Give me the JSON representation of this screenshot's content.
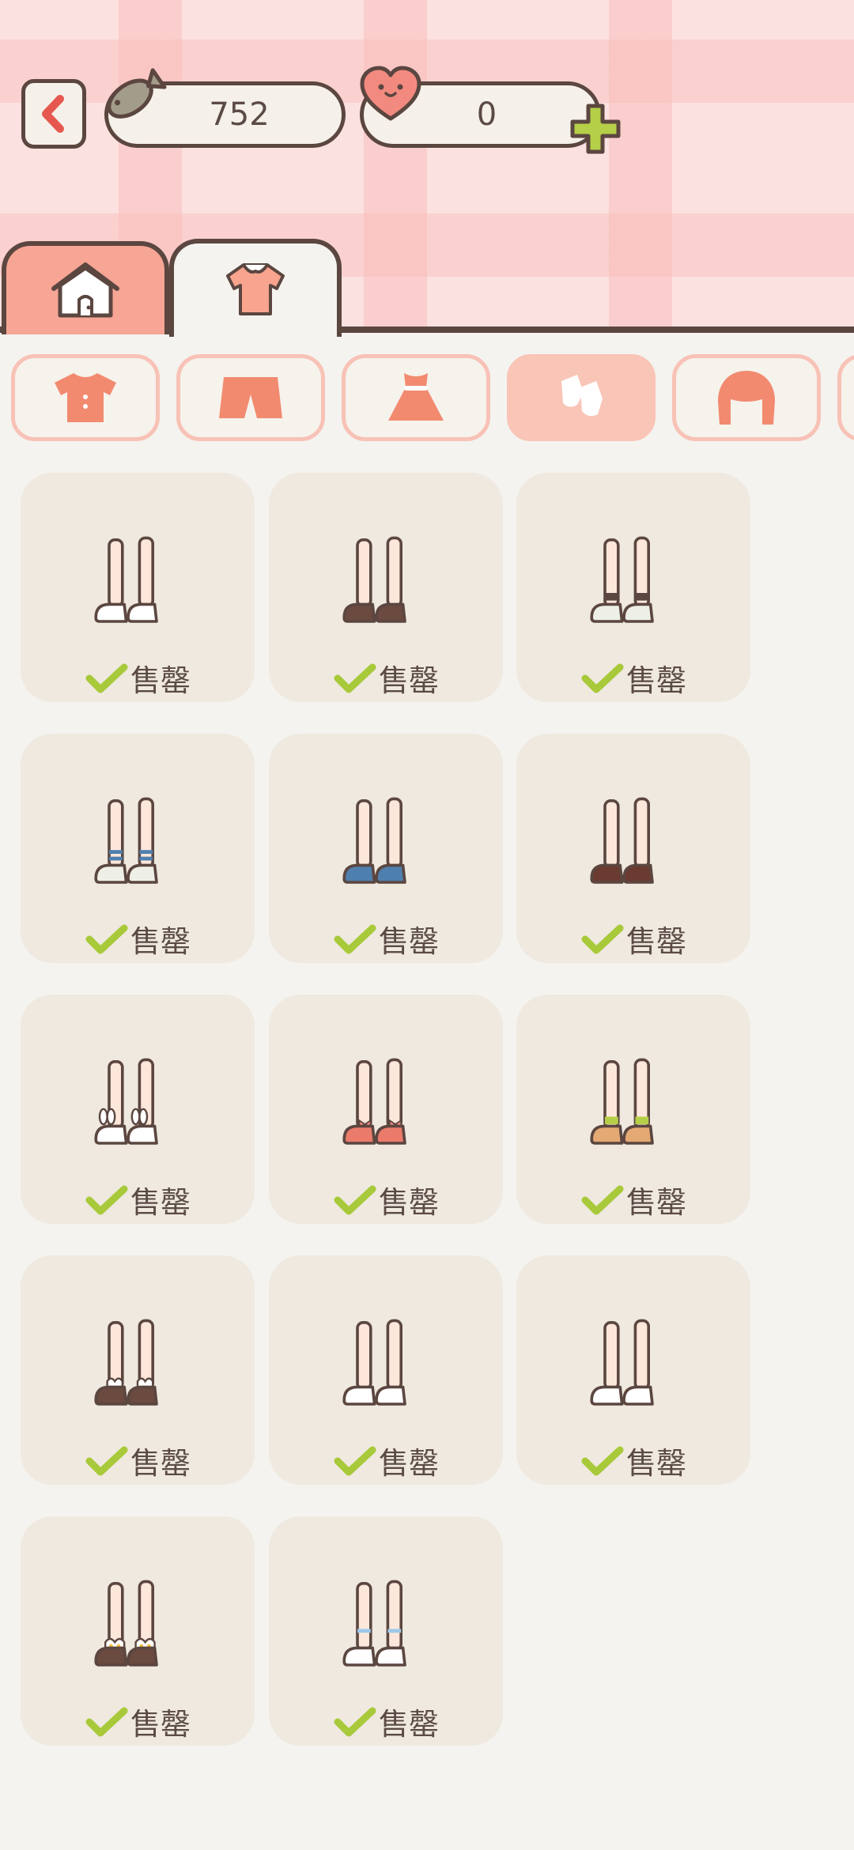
{
  "currency": {
    "fish_count": "752",
    "heart_count": "0"
  },
  "tabs": [
    {
      "name": "home",
      "icon": "house-icon"
    },
    {
      "name": "clothes",
      "icon": "shirt-icon"
    }
  ],
  "categories": [
    {
      "icon": "tshirt-icon"
    },
    {
      "icon": "shorts-icon"
    },
    {
      "icon": "dress-icon"
    },
    {
      "icon": "socks-icon",
      "active": true
    },
    {
      "icon": "hair-icon"
    }
  ],
  "items": [
    {
      "status": "售罄",
      "shoe_color": "#ffffff",
      "sock": "none"
    },
    {
      "status": "售罄",
      "shoe_color": "#6b4a40",
      "sock": "none"
    },
    {
      "status": "售罄",
      "shoe_color": "#eef0e8",
      "sock": "dark"
    },
    {
      "status": "售罄",
      "shoe_color": "#eef0e8",
      "sock": "blue-stripe"
    },
    {
      "status": "售罄",
      "shoe_color": "#4f7fae",
      "sock": "none"
    },
    {
      "status": "售罄",
      "shoe_color": "#6b3a30",
      "sock": "none"
    },
    {
      "status": "售罄",
      "shoe_color": "#ffffff",
      "sock": "bunny"
    },
    {
      "status": "售罄",
      "shoe_color": "#ea7b6b",
      "sock": "bow"
    },
    {
      "status": "售罄",
      "shoe_color": "#e5a974",
      "sock": "green"
    },
    {
      "status": "售罄",
      "shoe_color": "#6b4a40",
      "sock": "ruffle"
    },
    {
      "status": "售罄",
      "shoe_color": "#ffffff",
      "sock": "pink-pom"
    },
    {
      "status": "售罄",
      "shoe_color": "#ffffff",
      "sock": "none"
    },
    {
      "status": "售罄",
      "shoe_color": "#6b4a40",
      "sock": "yellow-frill"
    },
    {
      "status": "售罄",
      "shoe_color": "#ffffff",
      "sock": "blue-lace"
    }
  ],
  "colors": {
    "accent": "#f7a595",
    "outline": "#5b4640",
    "check": "#a8c93a",
    "card": "#efe9df"
  }
}
